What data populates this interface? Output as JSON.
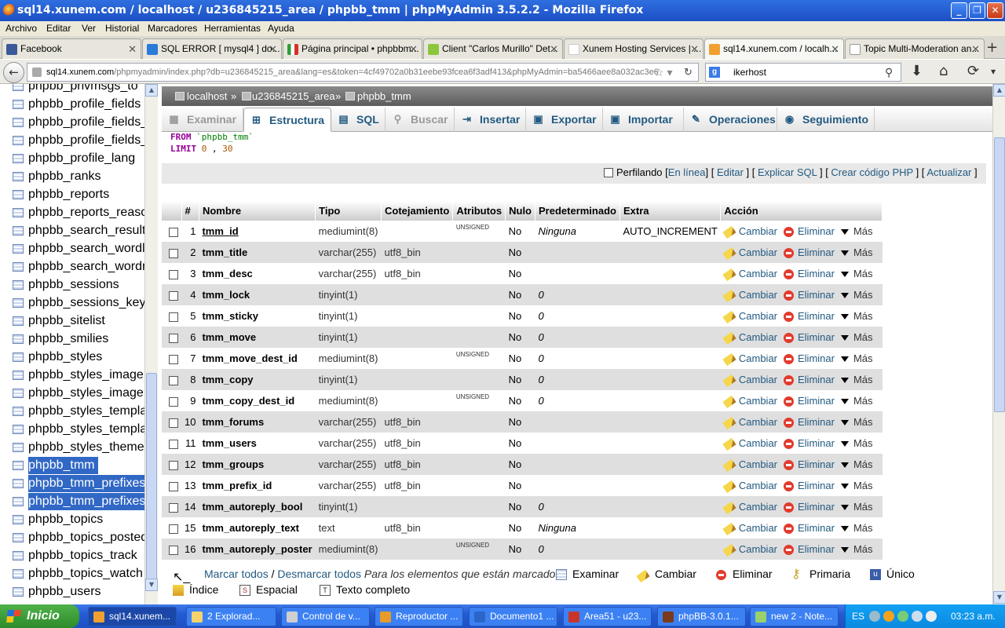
{
  "window": {
    "title": "sql14.xunem.com / localhost / u236845215_area / phpbb_tmm | phpMyAdmin 3.5.2.2 - Mozilla Firefox",
    "controls": [
      "_",
      "❐",
      "✕"
    ]
  },
  "menu": [
    "Archivo",
    "Editar",
    "Ver",
    "Historial",
    "Marcadores",
    "Herramientas",
    "Ayuda"
  ],
  "tabs": [
    {
      "label": "Facebook",
      "color": "#3b5998"
    },
    {
      "label": "SQL ERROR [ mysql4 ] do...",
      "color": "#2a7ad8"
    },
    {
      "label": "Página principal • phpbbm...",
      "color": "#2f9c3a"
    },
    {
      "label": "Client \"Carlos Murillo\" Det...",
      "color": "#8cc63f"
    },
    {
      "label": "Xunem Hosting Services | ...",
      "color": "#ffffff"
    },
    {
      "label": "sql14.xunem.com / localh...",
      "color": "#f0a030"
    },
    {
      "label": "Topic Multi-Moderation an...",
      "color": "#dddddd"
    }
  ],
  "nav": {
    "url_host": "sql14.xunem.com",
    "url_path": "/phpmyadmin/index.php?db=u236845215_area&lang=es&token=4cf49702a0b31eebe93fcea6f3adf413&phpMyAdmin=ba5466aee8a032ac3e6",
    "search_value": "ikerhost",
    "search_engine": "g"
  },
  "sidebar": {
    "items": [
      {
        "label": "phpbb_privmsgs_to",
        "selected": false
      },
      {
        "label": "phpbb_profile_fields",
        "selected": false
      },
      {
        "label": "phpbb_profile_fields_",
        "selected": false
      },
      {
        "label": "phpbb_profile_fields_",
        "selected": false
      },
      {
        "label": "phpbb_profile_lang",
        "selected": false
      },
      {
        "label": "phpbb_ranks",
        "selected": false
      },
      {
        "label": "phpbb_reports",
        "selected": false
      },
      {
        "label": "phpbb_reports_reaso",
        "selected": false
      },
      {
        "label": "phpbb_search_result",
        "selected": false
      },
      {
        "label": "phpbb_search_wordl",
        "selected": false
      },
      {
        "label": "phpbb_search_wordn",
        "selected": false
      },
      {
        "label": "phpbb_sessions",
        "selected": false
      },
      {
        "label": "phpbb_sessions_key",
        "selected": false
      },
      {
        "label": "phpbb_sitelist",
        "selected": false
      },
      {
        "label": "phpbb_smilies",
        "selected": false
      },
      {
        "label": "phpbb_styles",
        "selected": false
      },
      {
        "label": "phpbb_styles_image",
        "selected": false
      },
      {
        "label": "phpbb_styles_image",
        "selected": false
      },
      {
        "label": "phpbb_styles_templa",
        "selected": false
      },
      {
        "label": "phpbb_styles_templa",
        "selected": false
      },
      {
        "label": "phpbb_styles_theme",
        "selected": false
      },
      {
        "label": "phpbb_tmm",
        "selected": true
      },
      {
        "label": "phpbb_tmm_prefixes",
        "selected": true
      },
      {
        "label": "phpbb_tmm_prefixes",
        "selected": true
      },
      {
        "label": "phpbb_topics",
        "selected": false
      },
      {
        "label": "phpbb_topics_posted",
        "selected": false
      },
      {
        "label": "phpbb_topics_track",
        "selected": false
      },
      {
        "label": "phpbb_topics_watch",
        "selected": false
      },
      {
        "label": "phpbb_users",
        "selected": false
      }
    ]
  },
  "breadcrumb": [
    "localhost",
    "»",
    "u236845215_area",
    "»",
    "phpbb_tmm"
  ],
  "toptabs": [
    {
      "label": "Examinar",
      "icon": "▦",
      "state": "disabled"
    },
    {
      "label": "Estructura",
      "icon": "⊞",
      "state": "active"
    },
    {
      "label": "SQL",
      "icon": "▤",
      "state": "normal"
    },
    {
      "label": "Buscar",
      "icon": "⚲",
      "state": "disabled"
    },
    {
      "label": "Insertar",
      "icon": "⇥",
      "state": "normal"
    },
    {
      "label": "Exportar",
      "icon": "▣",
      "state": "normal"
    },
    {
      "label": "Importar",
      "icon": "▣",
      "state": "normal"
    },
    {
      "label": "Operaciones",
      "icon": "✎",
      "state": "normal"
    },
    {
      "label": "Seguimiento",
      "icon": "◉",
      "state": "normal"
    }
  ],
  "sql": {
    "from_kw": "FROM",
    "from_table": "`phpbb_tmm`",
    "limit_kw": "LIMIT",
    "limit_start": "0",
    "limit_sep": ",",
    "limit_count": "30"
  },
  "profiling": {
    "label": "Perfilando",
    "links": [
      "En línea",
      "Editar",
      "Explicar SQL",
      "Crear código PHP",
      "Actualizar"
    ]
  },
  "table": {
    "headers": [
      "",
      "#",
      "Nombre",
      "Tipo",
      "Cotejamiento",
      "Atributos",
      "Nulo",
      "Predeterminado",
      "Extra",
      "Acción"
    ],
    "rows": [
      {
        "n": "1",
        "name": "tmm_id",
        "type": "mediumint(8)",
        "coll": "",
        "attr": "UNSIGNED",
        "null": "No",
        "def": "Ninguna",
        "extra": "AUTO_INCREMENT"
      },
      {
        "n": "2",
        "name": "tmm_title",
        "type": "varchar(255)",
        "coll": "utf8_bin",
        "attr": "",
        "null": "No",
        "def": "",
        "extra": ""
      },
      {
        "n": "3",
        "name": "tmm_desc",
        "type": "varchar(255)",
        "coll": "utf8_bin",
        "attr": "",
        "null": "No",
        "def": "",
        "extra": ""
      },
      {
        "n": "4",
        "name": "tmm_lock",
        "type": "tinyint(1)",
        "coll": "",
        "attr": "",
        "null": "No",
        "def": "0",
        "extra": ""
      },
      {
        "n": "5",
        "name": "tmm_sticky",
        "type": "tinyint(1)",
        "coll": "",
        "attr": "",
        "null": "No",
        "def": "0",
        "extra": ""
      },
      {
        "n": "6",
        "name": "tmm_move",
        "type": "tinyint(1)",
        "coll": "",
        "attr": "",
        "null": "No",
        "def": "0",
        "extra": ""
      },
      {
        "n": "7",
        "name": "tmm_move_dest_id",
        "type": "mediumint(8)",
        "coll": "",
        "attr": "UNSIGNED",
        "null": "No",
        "def": "0",
        "extra": ""
      },
      {
        "n": "8",
        "name": "tmm_copy",
        "type": "tinyint(1)",
        "coll": "",
        "attr": "",
        "null": "No",
        "def": "0",
        "extra": ""
      },
      {
        "n": "9",
        "name": "tmm_copy_dest_id",
        "type": "mediumint(8)",
        "coll": "",
        "attr": "UNSIGNED",
        "null": "No",
        "def": "0",
        "extra": ""
      },
      {
        "n": "10",
        "name": "tmm_forums",
        "type": "varchar(255)",
        "coll": "utf8_bin",
        "attr": "",
        "null": "No",
        "def": "",
        "extra": ""
      },
      {
        "n": "11",
        "name": "tmm_users",
        "type": "varchar(255)",
        "coll": "utf8_bin",
        "attr": "",
        "null": "No",
        "def": "",
        "extra": ""
      },
      {
        "n": "12",
        "name": "tmm_groups",
        "type": "varchar(255)",
        "coll": "utf8_bin",
        "attr": "",
        "null": "No",
        "def": "",
        "extra": ""
      },
      {
        "n": "13",
        "name": "tmm_prefix_id",
        "type": "varchar(255)",
        "coll": "utf8_bin",
        "attr": "",
        "null": "No",
        "def": "",
        "extra": ""
      },
      {
        "n": "14",
        "name": "tmm_autoreply_bool",
        "type": "tinyint(1)",
        "coll": "",
        "attr": "",
        "null": "No",
        "def": "0",
        "extra": ""
      },
      {
        "n": "15",
        "name": "tmm_autoreply_text",
        "type": "text",
        "coll": "utf8_bin",
        "attr": "",
        "null": "No",
        "def": "Ninguna",
        "extra": ""
      },
      {
        "n": "16",
        "name": "tmm_autoreply_poster",
        "type": "mediumint(8)",
        "coll": "",
        "attr": "UNSIGNED",
        "null": "No",
        "def": "0",
        "extra": ""
      }
    ],
    "actions": {
      "change": "Cambiar",
      "delete": "Eliminar",
      "more": "Más"
    }
  },
  "bulk": {
    "check_all": "Marcar todos",
    "separator": "/",
    "uncheck_all": "Desmarcar todos",
    "hint": "Para los elementos que están marcados:",
    "buttons": [
      "Examinar",
      "Cambiar",
      "Eliminar",
      "Primaria",
      "Único",
      "Índice",
      "Espacial",
      "Texto completo"
    ]
  },
  "taskbar": {
    "start": "Inicio",
    "buttons": [
      {
        "label": "sql14.xunem...",
        "color": "#f0a030",
        "active": true
      },
      {
        "label": "2 Explorad...",
        "color": "#f5d36a",
        "active": false
      },
      {
        "label": "Control de v...",
        "color": "#cfcfcf",
        "active": false
      },
      {
        "label": "Reproductor ...",
        "color": "#e89b2a",
        "active": false
      },
      {
        "label": "Documento1 ...",
        "color": "#2c65c8",
        "active": false
      },
      {
        "label": "Area51 - u23...",
        "color": "#c8362a",
        "active": false
      },
      {
        "label": "phpBB-3.0.1...",
        "color": "#7a3a1c",
        "active": false
      },
      {
        "label": "new 2 - Note...",
        "color": "#9bd16a",
        "active": false
      }
    ],
    "lang": "ES",
    "clock": "03:23 a.m."
  }
}
